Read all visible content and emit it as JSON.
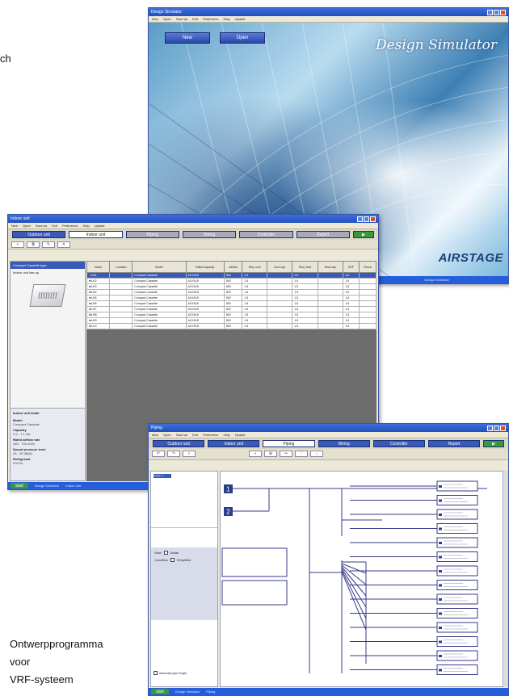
{
  "page": {
    "fragment": "ch",
    "caption": [
      "Ontwerpprogramma",
      "voor",
      "VRF-systeem"
    ]
  },
  "splash": {
    "title": "Design Simulator",
    "menu": [
      "New",
      "Open",
      "Save as",
      "Exit",
      "Preference",
      "Help",
      "Update"
    ],
    "buttons": [
      "New",
      "Open"
    ],
    "logo_script": "Design Simulator",
    "logo_brand": "AIRSTAGE",
    "taskbar_item": "Design Simulator"
  },
  "selection": {
    "title": "Indoor unit",
    "menu": [
      "New",
      "Open",
      "Save as",
      "Exit",
      "Preference",
      "Help",
      "Update"
    ],
    "tabs": [
      "Outdoor unit",
      "Indoor unit",
      "Piping",
      "Wiring",
      "Controller",
      "Report"
    ],
    "left_header": "Compact Cassette type",
    "left_sub": "Indoor unit line-up",
    "details_header": "Indoor unit detail",
    "details": [
      {
        "k": "Model",
        "v": "Compact Cassette"
      },
      {
        "k": "Capacity",
        "v": "2.2 - 7.1 kW"
      },
      {
        "k": "Rated airflow rate",
        "v": "450 - 700 m3/h"
      },
      {
        "k": "Sound pressure level",
        "v": "28 - 35 dB(A)"
      },
      {
        "k": "Refrigerant",
        "v": "R410A"
      }
    ],
    "columns": [
      "Name",
      "Location",
      "Model",
      "Rated capacity",
      "Airflow",
      "Req. cool",
      "Cool cap.",
      "Req. heat",
      "Heat cap.",
      "SHF",
      "Check"
    ],
    "rows": [
      [
        "IU01",
        "",
        "Compact Cassette",
        "AUYA18",
        "800",
        "1.8",
        "",
        "1.8",
        "",
        "1.8",
        ""
      ],
      [
        "IU02",
        "",
        "Compact Cassette",
        "AUYA18",
        "800",
        "1.8",
        "",
        "1.8",
        "",
        "1.8",
        ""
      ],
      [
        "IU03",
        "",
        "Compact Cassette",
        "AUYA18",
        "800",
        "1.8",
        "",
        "1.8",
        "",
        "1.8",
        ""
      ],
      [
        "IU04",
        "",
        "Compact Cassette",
        "AUYA18",
        "800",
        "1.8",
        "",
        "1.8",
        "",
        "1.8",
        ""
      ],
      [
        "IU05",
        "",
        "Compact Cassette",
        "AUYA18",
        "800",
        "1.8",
        "",
        "1.8",
        "",
        "1.8",
        ""
      ],
      [
        "IU06",
        "",
        "Compact Cassette",
        "AUYA18",
        "800",
        "1.8",
        "",
        "1.8",
        "",
        "1.8",
        ""
      ],
      [
        "IU07",
        "",
        "Compact Cassette",
        "AUYA18",
        "800",
        "1.8",
        "",
        "1.8",
        "",
        "1.8",
        ""
      ],
      [
        "IU08",
        "",
        "Compact Cassette",
        "AUYA18",
        "800",
        "1.8",
        "",
        "1.8",
        "",
        "1.8",
        ""
      ],
      [
        "IU09",
        "",
        "Compact Cassette",
        "AUYA18",
        "800",
        "1.8",
        "",
        "1.8",
        "",
        "1.8",
        ""
      ],
      [
        "IU10",
        "",
        "Compact Cassette",
        "AUYA18",
        "800",
        "1.8",
        "",
        "1.8",
        "",
        "1.8",
        ""
      ]
    ],
    "taskbar": [
      "start",
      "Design Simulator",
      "Indoor unit"
    ]
  },
  "piping": {
    "title": "Piping",
    "menu": [
      "New",
      "Open",
      "Save as",
      "Exit",
      "Preference",
      "Help",
      "Update"
    ],
    "tabs": [
      "Outdoor unit",
      "Indoor unit",
      "Piping",
      "Wiring",
      "Controller",
      "Report"
    ],
    "toolbar": [
      "Undo",
      "Redo",
      "Zoom",
      "Branch",
      "Join",
      "Pipe",
      "Up",
      "Down"
    ],
    "tree_node": "System 1",
    "view_label": "View",
    "view_option_1": "Detail",
    "condition_label": "Condition",
    "view_option_2": "Simplified",
    "auto_length": "Automatic pipe length",
    "outdoor_units": [
      "1",
      "2"
    ],
    "taskbar": [
      "start",
      "Design Simulator",
      "Piping"
    ]
  },
  "colors": {
    "window_blue": "#3a5ab8",
    "pipe_blue": "#3a3a8a",
    "taskbar": "#245edb",
    "brand": "#1c3e7a"
  }
}
